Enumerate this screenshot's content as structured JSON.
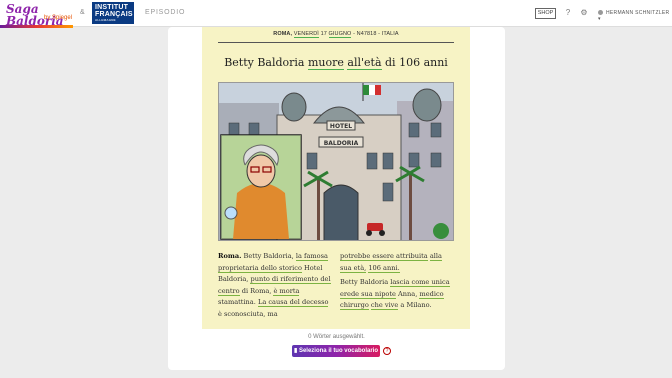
{
  "header": {
    "brand": "Saga Baldoria",
    "brand_sub": "by Spiegel",
    "amp": "&",
    "partner": {
      "line1": "INSTITUT",
      "line2": "FRANÇAIS",
      "line3": "ALLEMAGNE"
    },
    "episode_label": "EPISODIO",
    "shop_label": "SHOP",
    "user_name": "HERMANN SCHNITZLER"
  },
  "article": {
    "dateline_city": "ROMA,",
    "dateline_weekday": "VENERDÌ",
    "dateline_day": "17",
    "dateline_month": "GIUGNO",
    "dateline_rest": "- N47818 - ITALIA",
    "headline_pre": "Betty Baldoria",
    "headline_w1": "muore",
    "headline_mid": "all'età",
    "headline_w2": "di 106 anni",
    "illustration_sign1": "HOTEL",
    "illustration_sign2": "BALDORIA",
    "col1": {
      "lead": "Roma.",
      "t1": "Betty Baldoria,",
      "u1": "la famosa proprietaria dello storico",
      "t2": "Hotel Baldoria,",
      "u2": "punto di riferimento del centro",
      "t3": "di Roma,",
      "u3": "è morta",
      "t4": "stamattina.",
      "u4": "La causa del decesso",
      "t5": "è sconosciuta,",
      "u5": "ma"
    },
    "col2": {
      "p1a": "potrebbe essere attribuita",
      "p1b": "alla sua età,",
      "p1c": "106 anni.",
      "p2a": "Betty Baldoria",
      "p2b": "lascia come unica erede sua nipote",
      "p2c": "Anna,",
      "p2d": "medico chirurgo",
      "p2e": "che vive",
      "p2f": "a Milano."
    }
  },
  "footer": {
    "word_count": "0 Wörter ausgewählt.",
    "vocab_button": "Seleziona il tuo vocabolario",
    "help": "?"
  }
}
